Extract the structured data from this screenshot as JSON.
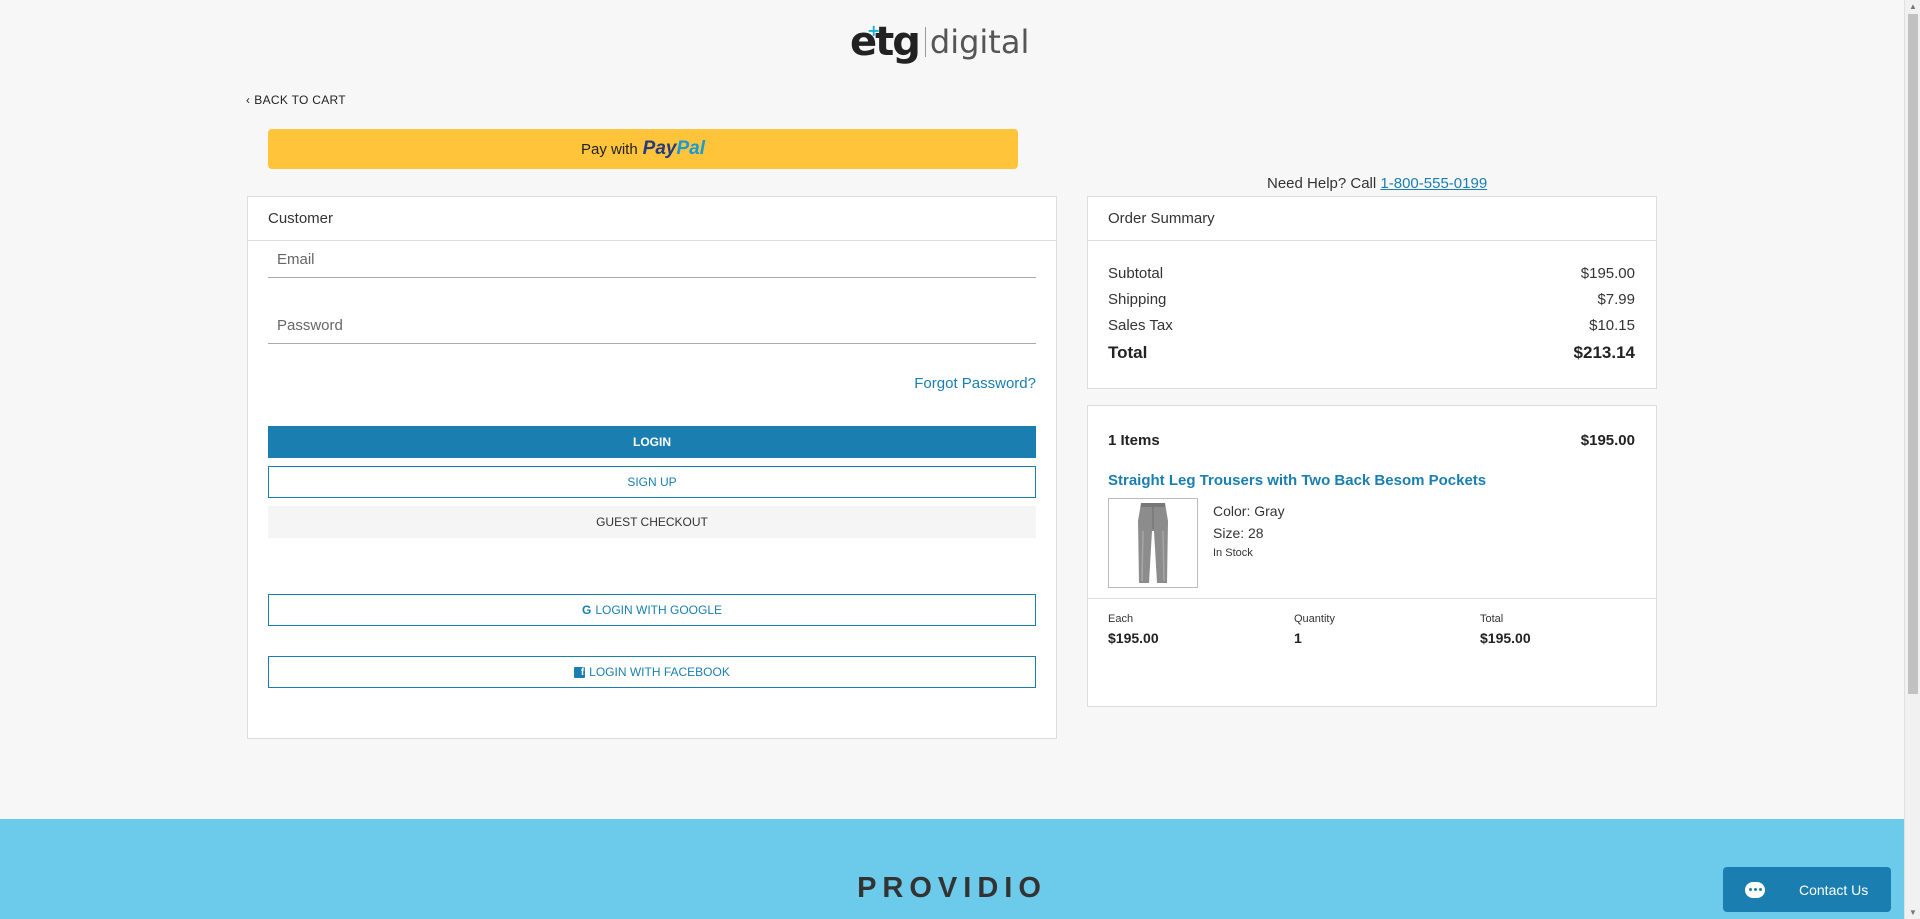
{
  "logo": {
    "etg": "etg",
    "digital": "digital"
  },
  "nav": {
    "back_label": "BACK TO CART"
  },
  "paypal": {
    "prefix": "Pay with",
    "brand1": "Pay",
    "brand2": "Pal"
  },
  "help": {
    "text": "Need Help? Call",
    "phone": "1-800-555-0199"
  },
  "customer": {
    "title": "Customer",
    "email_placeholder": "Email",
    "password_placeholder": "Password",
    "forgot": "Forgot Password?",
    "login": "LOGIN",
    "signup": "SIGN UP",
    "guest": "GUEST CHECKOUT",
    "google": "LOGIN WITH GOOGLE",
    "facebook": "LOGIN WITH FACEBOOK"
  },
  "summary": {
    "title": "Order Summary",
    "rows": [
      {
        "label": "Subtotal",
        "value": "$195.00"
      },
      {
        "label": "Shipping",
        "value": "$7.99"
      },
      {
        "label": "Sales Tax",
        "value": "$10.15"
      },
      {
        "label": "Total",
        "value": "$213.14"
      }
    ]
  },
  "cart": {
    "count_label": "1 Items",
    "count_total": "$195.00",
    "product": {
      "name": "Straight Leg Trousers with Two Back Besom Pockets",
      "color": "Color: Gray",
      "size": "Size: 28",
      "stock": "In Stock",
      "each_label": "Each",
      "each_value": "$195.00",
      "qty_label": "Quantity",
      "qty_value": "1",
      "total_label": "Total",
      "total_value": "$195.00"
    }
  },
  "footer": {
    "brand": "PROVIDIO"
  },
  "chat": {
    "label": "Contact Us"
  },
  "colors": {
    "accent": "#1a7fb0",
    "paypal": "#ffc43a",
    "footer": "#6ccaeb"
  }
}
